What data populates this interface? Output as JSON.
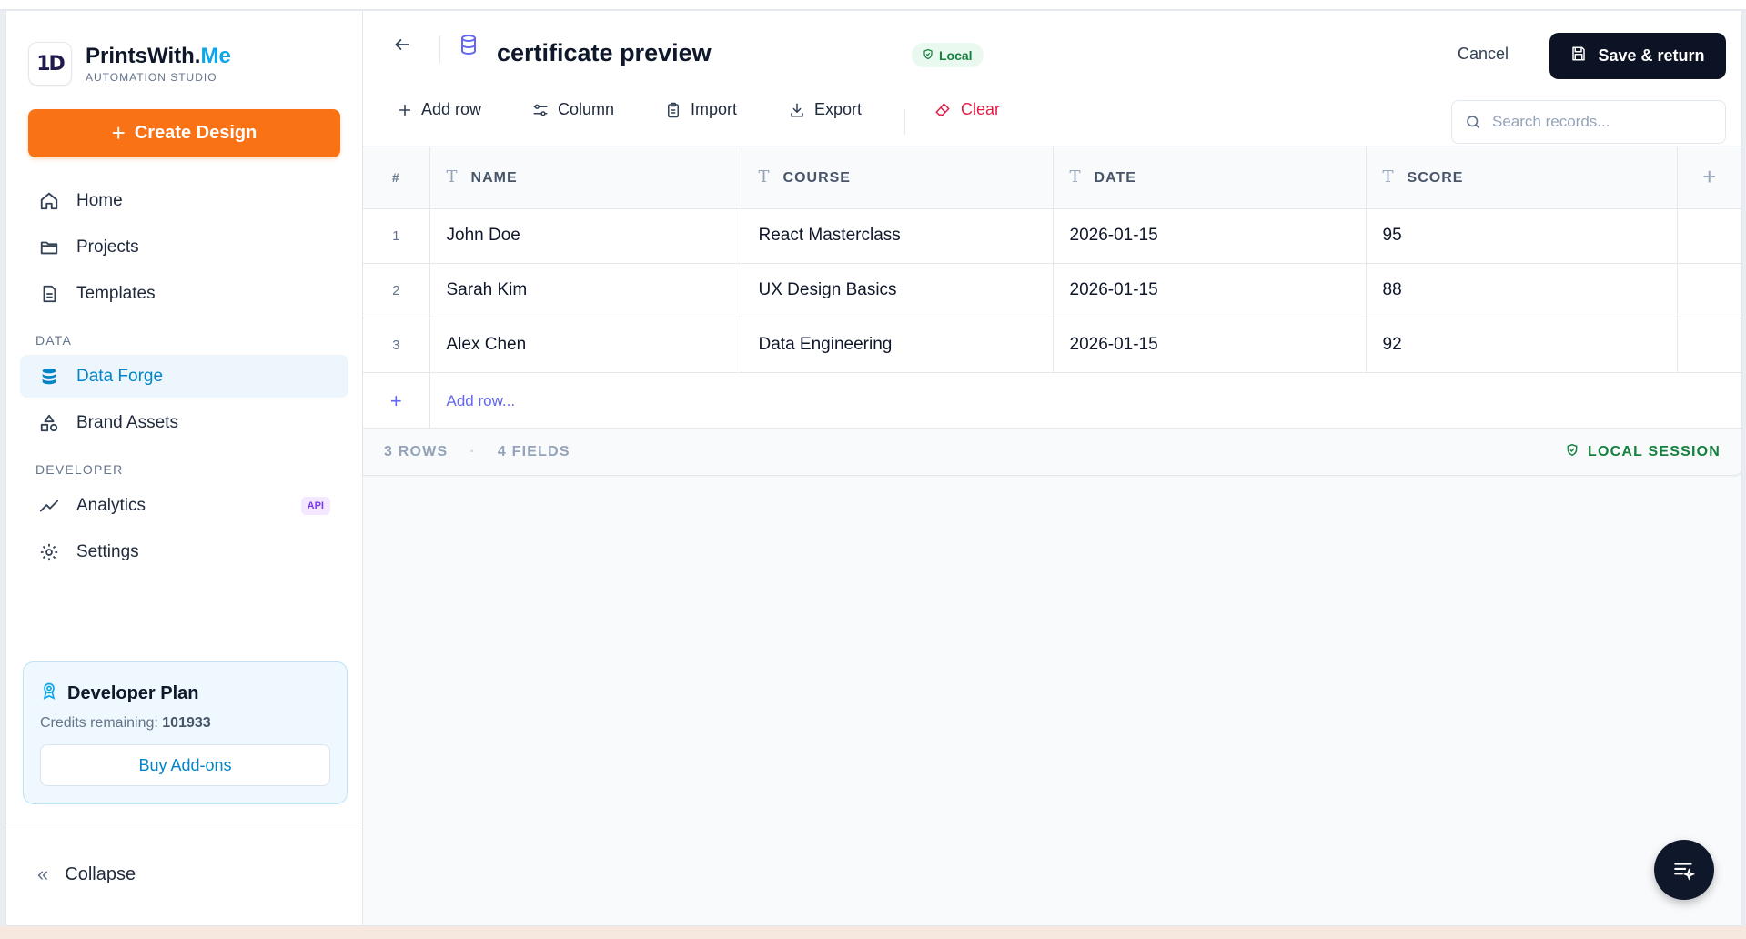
{
  "brand": {
    "name_main": "PrintsWith.",
    "name_accent": "Me",
    "subtitle": "AUTOMATION STUDIO",
    "logo_text": "1D"
  },
  "sidebar": {
    "create_label": "Create Design",
    "nav": [
      {
        "label": "Home",
        "icon": "home-icon"
      },
      {
        "label": "Projects",
        "icon": "folder-icon"
      },
      {
        "label": "Templates",
        "icon": "document-icon"
      }
    ],
    "section_data": "DATA",
    "data_items": [
      {
        "label": "Data Forge",
        "icon": "database-icon",
        "active": true
      },
      {
        "label": "Brand Assets",
        "icon": "shapes-icon"
      }
    ],
    "section_developer": "DEVELOPER",
    "dev_items": [
      {
        "label": "Analytics",
        "icon": "trend-icon",
        "badge": "API"
      },
      {
        "label": "Settings",
        "icon": "gear-icon"
      }
    ],
    "plan": {
      "title": "Developer Plan",
      "credits_label": "Credits remaining:",
      "credits_value": "101933",
      "button": "Buy Add-ons"
    },
    "collapse_label": "Collapse"
  },
  "header": {
    "title": "certificate preview",
    "badge": "Local",
    "cancel": "Cancel",
    "save": "Save & return"
  },
  "toolbar": {
    "add_row": "Add row",
    "column": "Column",
    "import": "Import",
    "export": "Export",
    "clear": "Clear",
    "search_placeholder": "Search records..."
  },
  "grid": {
    "num_header": "#",
    "columns": [
      "NAME",
      "COURSE",
      "DATE",
      "SCORE"
    ],
    "rows": [
      {
        "num": "1",
        "name": "John Doe",
        "course": "React Masterclass",
        "date": "2026-01-15",
        "score": "95"
      },
      {
        "num": "2",
        "name": "Sarah Kim",
        "course": "UX Design Basics",
        "date": "2026-01-15",
        "score": "88"
      },
      {
        "num": "3",
        "name": "Alex Chen",
        "course": "Data Engineering",
        "date": "2026-01-15",
        "score": "92"
      }
    ],
    "add_row_label": "Add row...",
    "footer_rows": "3 ROWS",
    "footer_fields": "4 FIELDS",
    "session": "LOCAL SESSION"
  },
  "colors": {
    "accent_orange": "#f97316",
    "accent_blue": "#0ea5e9",
    "dark": "#0b1324",
    "success": "#15803d",
    "danger": "#e11d48"
  }
}
